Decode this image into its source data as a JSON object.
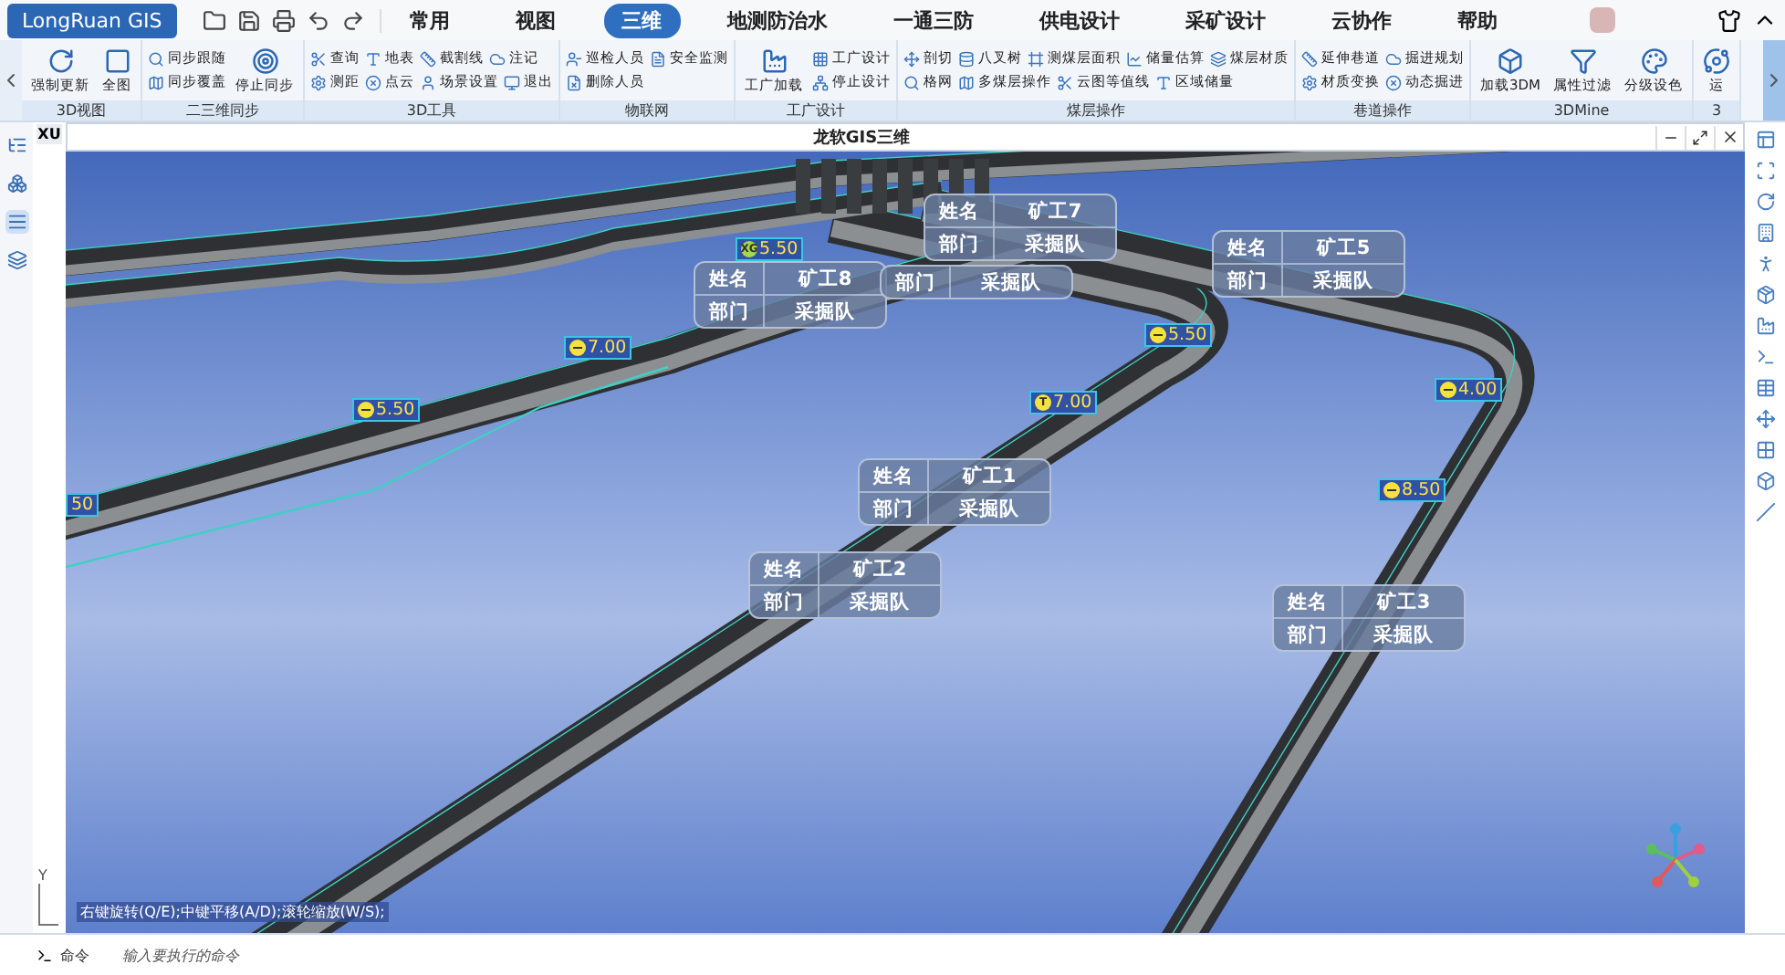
{
  "app": {
    "logo": "LongRuan GIS"
  },
  "menu_tabs": [
    {
      "label": "常用",
      "selected": false
    },
    {
      "label": "视图",
      "selected": false
    },
    {
      "label": "三维",
      "selected": true
    },
    {
      "label": "地测防治水",
      "selected": false
    },
    {
      "label": "一通三防",
      "selected": false
    },
    {
      "label": "供电设计",
      "selected": false
    },
    {
      "label": "采矿设计",
      "selected": false
    },
    {
      "label": "云协作",
      "selected": false
    },
    {
      "label": "帮助",
      "selected": false
    }
  ],
  "ribbon": {
    "groups": [
      {
        "label": "3D视图",
        "items": [
          {
            "kind": "large",
            "label": "强制更新"
          },
          {
            "kind": "large",
            "label": "全图"
          }
        ]
      },
      {
        "label": "二三维同步",
        "items": [
          {
            "kind": "stack",
            "rows": [
              [
                "同步跟随"
              ],
              [
                "同步覆盖"
              ]
            ]
          },
          {
            "kind": "large",
            "label": "停止同步"
          }
        ]
      },
      {
        "label": "3D工具",
        "items": [
          {
            "kind": "stack",
            "rows": [
              [
                "查询",
                "地表",
                "截割线",
                "注记"
              ],
              [
                "测距",
                "点云",
                "场景设置",
                "退出"
              ]
            ]
          }
        ]
      },
      {
        "label": "物联网",
        "items": [
          {
            "kind": "stack",
            "rows": [
              [
                "巡检人员",
                "安全监测"
              ],
              [
                "删除人员"
              ]
            ]
          }
        ]
      },
      {
        "label": "工广设计",
        "items": [
          {
            "kind": "large",
            "label": "工广加载"
          },
          {
            "kind": "stack",
            "rows": [
              [
                "工广设计"
              ],
              [
                "停止设计"
              ]
            ]
          }
        ]
      },
      {
        "label": "煤层操作",
        "items": [
          {
            "kind": "stack",
            "rows": [
              [
                "剖切",
                "八叉树",
                "测煤层面积",
                "储量估算",
                "煤层材质"
              ],
              [
                "格网",
                "多煤层操作",
                "云图等值线",
                "区域储量"
              ]
            ]
          }
        ]
      },
      {
        "label": "巷道操作",
        "items": [
          {
            "kind": "stack",
            "rows": [
              [
                "延伸巷道",
                "掘进规划"
              ],
              [
                "材质变换",
                "动态掘进"
              ]
            ]
          }
        ]
      },
      {
        "label": "3DMine",
        "items": [
          {
            "kind": "large",
            "label": "加载3DM"
          },
          {
            "kind": "large",
            "label": "属性过滤"
          },
          {
            "kind": "large",
            "label": "分级设色"
          }
        ]
      },
      {
        "label": "3",
        "items": [
          {
            "kind": "large",
            "label": "运"
          }
        ]
      }
    ]
  },
  "left_toolbar": {
    "items": [
      {
        "selected": false
      },
      {
        "selected": false
      },
      {
        "selected": true
      },
      {
        "selected": false
      }
    ]
  },
  "viewport": {
    "tab": "XU",
    "title": "龙软GIS三维",
    "hint": "右键旋转(Q/E);中键平移(A/D);滚轮缩放(W/S);",
    "axis_label": "Y"
  },
  "miner_labels": [
    {
      "rows": [
        {
          "label": "姓名",
          "value": "矿工8"
        },
        {
          "label": "部门",
          "value": "采掘队"
        }
      ]
    },
    {
      "rows": [
        {
          "label": "姓名",
          "value": "矿工7"
        },
        {
          "label": "部门",
          "value": "采掘队"
        }
      ]
    },
    {
      "rows": [
        {
          "label": "部门",
          "value": "采掘队"
        }
      ]
    },
    {
      "rows": [
        {
          "label": "姓名",
          "value": "矿工5"
        },
        {
          "label": "部门",
          "value": "采掘队"
        }
      ]
    },
    {
      "rows": [
        {
          "label": "姓名",
          "value": "矿工1"
        },
        {
          "label": "部门",
          "value": "采掘队"
        }
      ]
    },
    {
      "rows": [
        {
          "label": "姓名",
          "value": "矿工2"
        },
        {
          "label": "部门",
          "value": "采掘队"
        }
      ]
    },
    {
      "rows": [
        {
          "label": "姓名",
          "value": "矿工3"
        },
        {
          "label": "部门",
          "value": "采掘队"
        }
      ]
    }
  ],
  "height_markers": [
    {
      "kind": "letter",
      "symbol": "XG",
      "color": "#a6d84a",
      "value": "5.50"
    },
    {
      "kind": "dash",
      "color": "#f5e23a",
      "value": "7.00"
    },
    {
      "kind": "dash",
      "color": "#f5e23a",
      "value": "5.50"
    },
    {
      "kind": "dash",
      "color": "#f5e23a",
      "value": "5.50"
    },
    {
      "kind": "letter",
      "symbol": "T",
      "color": "#f5e23a",
      "value": "7.00"
    },
    {
      "kind": "dash",
      "color": "#f5e23a",
      "value": "4.00"
    },
    {
      "kind": "dash",
      "color": "#f5e23a",
      "value": "8.50"
    },
    {
      "kind": "plain",
      "value": "50"
    }
  ],
  "command_bar": {
    "label": "命令",
    "placeholder": "输入要执行的命令"
  }
}
